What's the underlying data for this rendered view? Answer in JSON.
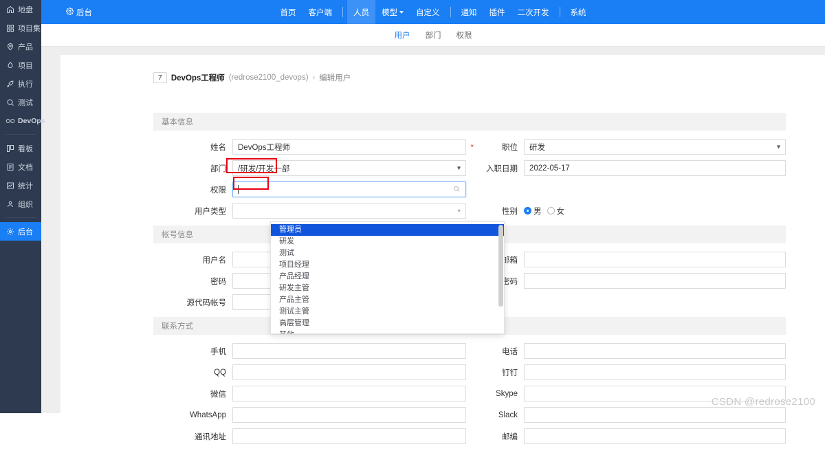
{
  "sidebar": {
    "groups": [
      {
        "items": [
          {
            "label": "地盘",
            "icon": "home-icon"
          },
          {
            "label": "项目集",
            "icon": "grid-icon"
          },
          {
            "label": "产品",
            "icon": "pin-icon"
          },
          {
            "label": "项目",
            "icon": "drop-icon"
          },
          {
            "label": "执行",
            "icon": "rocket-icon"
          },
          {
            "label": "测试",
            "icon": "magnifier-icon"
          },
          {
            "label": "DevOps",
            "icon": "infinity-icon",
            "latin": true
          }
        ]
      },
      {
        "items": [
          {
            "label": "看板",
            "icon": "kanban-icon"
          },
          {
            "label": "文档",
            "icon": "document-icon"
          },
          {
            "label": "统计",
            "icon": "chart-icon"
          },
          {
            "label": "组织",
            "icon": "people-icon"
          }
        ]
      },
      {
        "items": [
          {
            "label": "后台",
            "icon": "gear-icon",
            "active": true
          }
        ]
      }
    ]
  },
  "topbar": {
    "brand": "后台",
    "brand_icon": "gear-icon",
    "nav": [
      {
        "label": "首页"
      },
      {
        "label": "客户端"
      },
      {
        "divider": true
      },
      {
        "label": "人员",
        "active": true
      },
      {
        "label": "模型",
        "caret": true
      },
      {
        "label": "自定义"
      },
      {
        "divider": true
      },
      {
        "label": "通知"
      },
      {
        "label": "插件"
      },
      {
        "label": "二次开发"
      },
      {
        "divider": true
      },
      {
        "label": "系统"
      }
    ]
  },
  "subnav": {
    "items": [
      {
        "label": "用户",
        "active": true
      },
      {
        "label": "部门"
      },
      {
        "label": "权限"
      }
    ]
  },
  "breadcrumb": {
    "badge": "7",
    "title": "DevOps工程师",
    "account": "(redrose2100_devops)",
    "separator": "›",
    "action": "编辑用户"
  },
  "sections": {
    "basic": "基本信息",
    "account": "帐号信息",
    "contact": "联系方式"
  },
  "form": {
    "basic": [
      {
        "left": {
          "label": "姓名",
          "value": "DevOps工程师",
          "required": true,
          "type": "text"
        },
        "right": {
          "label": "职位",
          "value": "研发",
          "type": "select"
        }
      },
      {
        "left": {
          "label": "部门",
          "value": "/研发/开发一部",
          "type": "tree-select"
        },
        "right": {
          "label": "入职日期",
          "value": "2022-05-17",
          "type": "date"
        }
      },
      {
        "left": {
          "label": "权限",
          "value": "",
          "type": "search-select",
          "focused": true
        },
        "right": {
          "label": "",
          "value": "",
          "type": "none"
        }
      },
      {
        "left": {
          "label": "用户类型",
          "value": "",
          "type": "select"
        },
        "right": {
          "label": "性别",
          "type": "radio",
          "options": [
            {
              "label": "男",
              "checked": true
            },
            {
              "label": "女",
              "checked": false
            }
          ]
        }
      }
    ],
    "account": [
      {
        "left": {
          "label": "用户名",
          "value": "",
          "required": true,
          "type": "text"
        },
        "right": {
          "label": "邮箱",
          "value": "",
          "type": "text"
        }
      },
      {
        "left": {
          "label": "密码",
          "value": "",
          "type": "password"
        },
        "right": {
          "label": "请重复密码",
          "value": "",
          "type": "password"
        }
      },
      {
        "left": {
          "label": "源代码帐号",
          "value": "",
          "type": "text"
        },
        "right": {
          "label": "",
          "value": "",
          "type": "none"
        }
      }
    ],
    "contact": [
      {
        "left": {
          "label": "手机",
          "value": "",
          "type": "text"
        },
        "right": {
          "label": "电话",
          "value": "",
          "type": "text"
        }
      },
      {
        "left": {
          "label": "QQ",
          "value": "",
          "type": "text"
        },
        "right": {
          "label": "钉钉",
          "value": "",
          "type": "text"
        }
      },
      {
        "left": {
          "label": "微信",
          "value": "",
          "type": "text"
        },
        "right": {
          "label": "Skype",
          "value": "",
          "type": "text"
        }
      },
      {
        "left": {
          "label": "WhatsApp",
          "value": "",
          "type": "text"
        },
        "right": {
          "label": "Slack",
          "value": "",
          "type": "text"
        }
      },
      {
        "left": {
          "label": "通讯地址",
          "value": "",
          "type": "text"
        },
        "right": {
          "label": "邮编",
          "value": "",
          "type": "text"
        }
      }
    ]
  },
  "permission_dropdown": {
    "options": [
      {
        "label": "管理员",
        "selected": true
      },
      {
        "label": "研发"
      },
      {
        "label": "测试"
      },
      {
        "label": "项目经理"
      },
      {
        "label": "产品经理"
      },
      {
        "label": "研发主管"
      },
      {
        "label": "产品主管"
      },
      {
        "label": "测试主管"
      },
      {
        "label": "高层管理"
      },
      {
        "label": "其他"
      }
    ]
  },
  "watermark": "CSDN @redrose2100",
  "colors": {
    "brand_blue": "#1a7ef5",
    "sidebar_bg": "#2d3a4f",
    "dropdown_selected": "#1155dd",
    "annotation_red": "#e60012",
    "required_red": "#e8493f",
    "page_bg": "#eeeeee"
  }
}
